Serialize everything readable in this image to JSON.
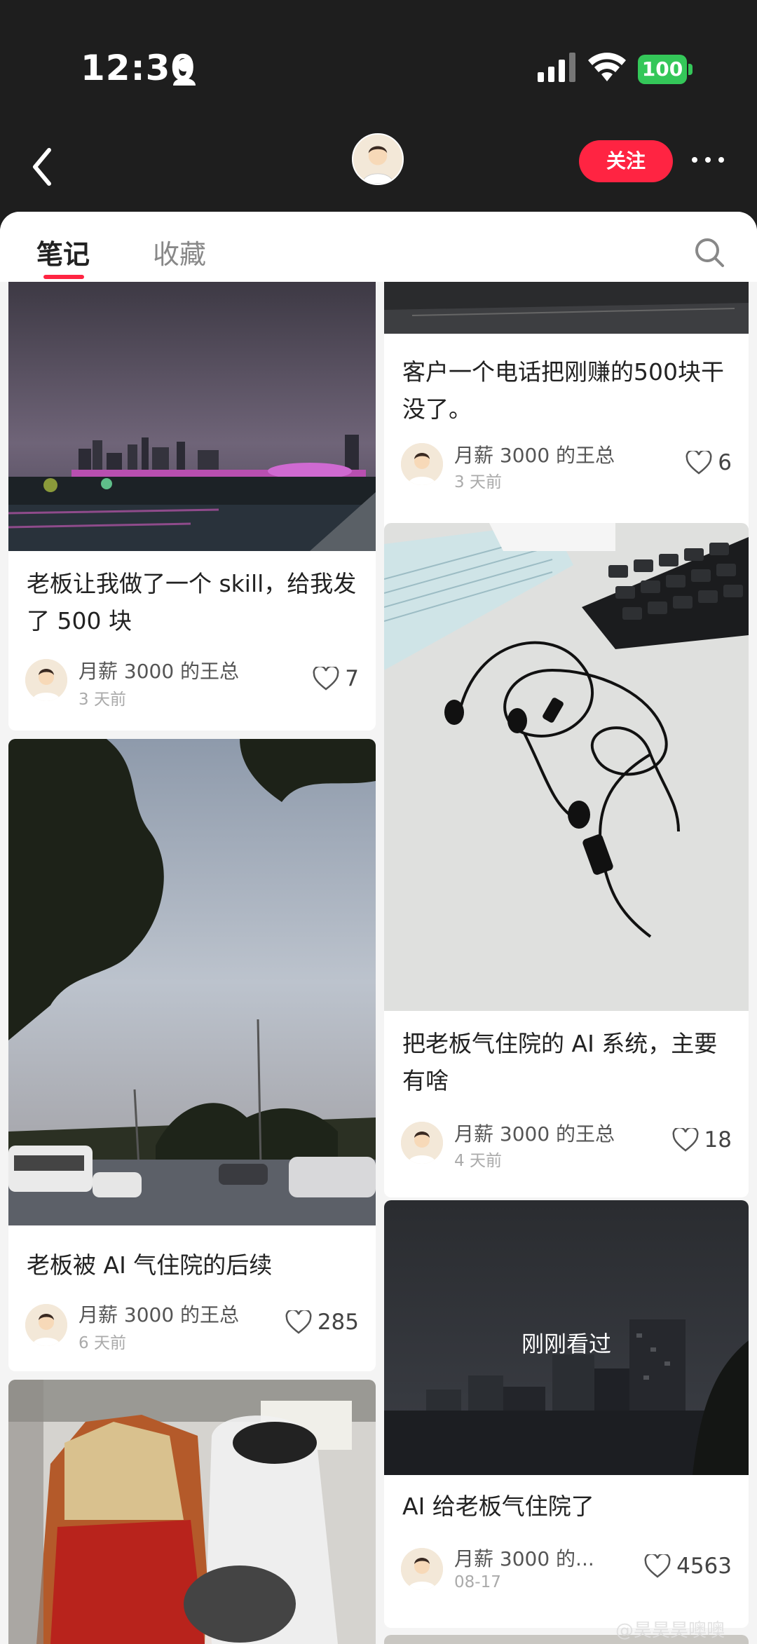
{
  "status": {
    "time": "12:30",
    "battery": "100"
  },
  "tabs": [
    {
      "label": "笔记"
    },
    {
      "label": "收藏"
    }
  ],
  "follow_label": "关注",
  "cards": [
    {
      "title": "客户一个电话把刚赚的500块干没了。",
      "author": "月薪 3000 的王总",
      "time": "3 天前",
      "likes": "6"
    },
    {
      "title": "老板让我做了一个 skill，给我发了 500 块",
      "author": "月薪 3000 的王总",
      "time": "3 天前",
      "likes": "7"
    },
    {
      "title": "把老板气住院的 AI 系统，主要有啥",
      "author": "月薪 3000 的王总",
      "time": "4 天前",
      "likes": "18"
    },
    {
      "title": "老板被 AI 气住院的后续",
      "author": "月薪 3000 的王总",
      "time": "6 天前",
      "likes": "285"
    },
    {
      "title": "AI 给老板气住院了",
      "author": "月薪 3000 的...",
      "time": "08-17",
      "likes": "4563",
      "overlay": "刚刚看过"
    }
  ],
  "watermark": "@昊昊昊噢噢",
  "colors": {
    "accent": "#ff2442",
    "battery": "#34c759"
  }
}
